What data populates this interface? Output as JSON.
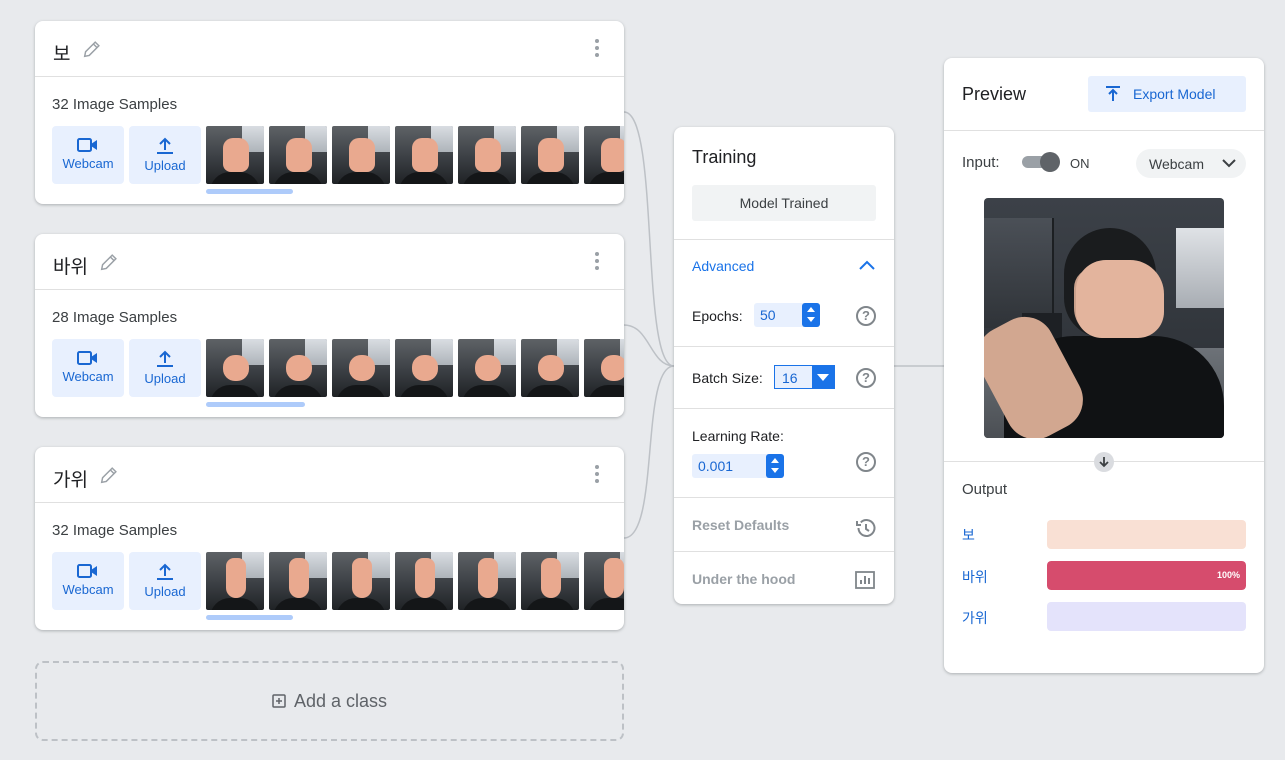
{
  "classes": [
    {
      "name": "보",
      "samples": "32 Image Samples",
      "webcam": "Webcam",
      "upload": "Upload"
    },
    {
      "name": "바위",
      "samples": "28 Image Samples",
      "webcam": "Webcam",
      "upload": "Upload"
    },
    {
      "name": "가위",
      "samples": "32 Image Samples",
      "webcam": "Webcam",
      "upload": "Upload"
    }
  ],
  "add_class": "Add a class",
  "training": {
    "title": "Training",
    "button": "Model Trained",
    "advanced": "Advanced",
    "epochs_label": "Epochs:",
    "epochs": "50",
    "batch_label": "Batch Size:",
    "batch": "16",
    "lr_label": "Learning Rate:",
    "lr": "0.001",
    "help": "?",
    "reset": "Reset Defaults",
    "hood": "Under the hood"
  },
  "preview": {
    "title": "Preview",
    "export": "Export Model",
    "input_label": "Input:",
    "toggle_state": "ON",
    "source": "Webcam",
    "output_title": "Output",
    "outputs": [
      {
        "label": "보",
        "confidence": 0,
        "pct": "",
        "color": "#f9e0d4",
        "track": "#fdeee6"
      },
      {
        "label": "바위",
        "confidence": 1.0,
        "pct": "100%",
        "color": "#d64c6d",
        "track": "#fbe3e8"
      },
      {
        "label": "가위",
        "confidence": 0,
        "pct": "",
        "color": "#e4e3fb",
        "track": "#efeffc"
      }
    ]
  },
  "colors": {
    "accent": "#1a73e8",
    "accent_light": "#e8f0fe",
    "progress": "#aecbfa"
  }
}
